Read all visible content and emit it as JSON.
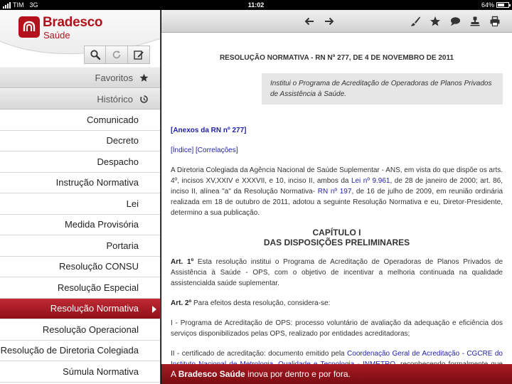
{
  "status_bar": {
    "carrier": "TIM",
    "network": "3G",
    "time": "11:02",
    "battery_text": "64%",
    "battery_level": 0.64
  },
  "sidebar": {
    "brand_name": "Bradesco",
    "brand_sub": "Saúde",
    "tools": [
      "search-icon",
      "refresh-icon",
      "edit-icon"
    ],
    "favorites_label": "Favoritos",
    "history_label": "Histórico",
    "items": [
      {
        "label": "Comunicado",
        "active": false
      },
      {
        "label": "Decreto",
        "active": false
      },
      {
        "label": "Despacho",
        "active": false
      },
      {
        "label": "Instrução Normativa",
        "active": false
      },
      {
        "label": "Lei",
        "active": false
      },
      {
        "label": "Medida Provisória",
        "active": false
      },
      {
        "label": "Portaria",
        "active": false
      },
      {
        "label": "Resolução CONSU",
        "active": false
      },
      {
        "label": "Resolução Especial",
        "active": false
      },
      {
        "label": "Resolução Normativa",
        "active": true
      },
      {
        "label": "Resolução Operacional",
        "active": false
      },
      {
        "label": "Resolução de Diretoria Colegiada",
        "active": false
      },
      {
        "label": "Súmula Normativa",
        "active": false
      }
    ]
  },
  "toolbar": {
    "icons": [
      "back-arrow-icon",
      "forward-arrow-icon",
      "brush-icon",
      "star-icon",
      "comment-icon",
      "stamp-icon",
      "print-icon"
    ]
  },
  "document": {
    "title": "RESOLUÇÃO NORMATIVA - RN Nº 277, DE 4 DE NOVEMBRO DE 2011",
    "summary": "Institui o Programa de Acreditação de Operadoras de Planos Privados de Assistência à Saúde.",
    "annex": "[Anexos da RN nº 277]",
    "index_link": "[Índice]",
    "correlations_link": "[Correlações]",
    "p1_a": "A Diretoria Colegiada da Agência Nacional de Saúde Suplementar - ANS, em vista do que dispõe os arts. 4º, incisos XV,XXIV e XXXVII, e 10, inciso II, ambos da ",
    "p1_link1": "Lei nº 9.961",
    "p1_b": ", de 28 de janeiro de 2000; art. 86, inciso II, alínea \"a\" da Resolução Normativa- ",
    "p1_link2": "RN nº 197",
    "p1_c": ", de 16 de julho de 2009, em reunião ordinária realizada em 18 de outubro de 2011, adotou a seguinte Resolução Normativa e eu, Diretor-Presidente, determino a sua publicação.",
    "chapter_line1": "CAPÍTULO I",
    "chapter_line2": "DAS DISPOSIÇÕES PRELIMINARES",
    "art1_label": "Art. 1º",
    "art1_text": " Esta resolução institui o Programa de Acreditação de Operadoras de Planos Privados de Assistência à Saúde - OPS, com o objetivo de incentivar a melhoria continuada na qualidade assistencialda saúde suplementar.",
    "art2_label": "Art. 2º",
    "art2_text": " Para efeitos desta resolução, considera-se:",
    "item1": "I - Programa de Acreditação de OPS: processo voluntário de avaliação da adequação e eficiência dos serviços disponibilizados pelas OPS, realizado por entidades acreditadoras;",
    "item2_a": "II - certificado de acreditação: documento emitido pela ",
    "item2_link": "Coordenação Geral de Acreditação - CGCRE do Instituto Nacional de Metrologia, Qualidade e Tecnologia - INMETRO",
    "item2_b": ", reconhecendo formalmente que um"
  },
  "banner": {
    "prefix": "A ",
    "brand": "Bradesco Saúde",
    "suffix": " inova por dentro e por fora."
  }
}
